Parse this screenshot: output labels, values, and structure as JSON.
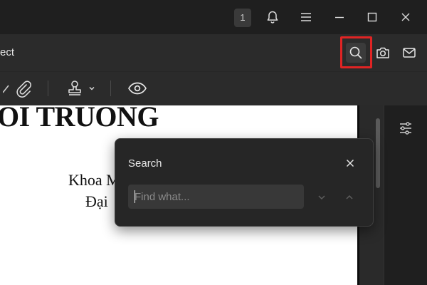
{
  "titlebar": {
    "notification_count": "1",
    "icons": [
      "bell-icon",
      "menu-icon",
      "minimize-icon",
      "maximize-icon",
      "close-icon"
    ]
  },
  "header": {
    "title": "ect",
    "icons": [
      "search-icon",
      "camera-icon",
      "mail-icon"
    ]
  },
  "toolbar": {
    "icons": [
      "attachment-icon",
      "stamp-icon",
      "chevron-down-icon",
      "eye-icon"
    ]
  },
  "document": {
    "heading": "OI TRUONG",
    "line1": "Khoa M",
    "line2": "Đại"
  },
  "search_panel": {
    "title": "Search",
    "placeholder": "Find what...",
    "value": ""
  },
  "colors": {
    "background": "#1f1f1f",
    "bar": "#2b2b2b",
    "highlight": "#e02424",
    "popover": "#262626"
  }
}
